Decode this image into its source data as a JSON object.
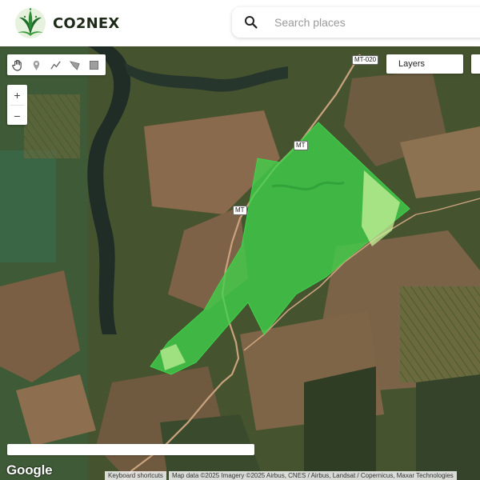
{
  "brand": {
    "name": "CO2NEX"
  },
  "search": {
    "placeholder": "Search places",
    "value": ""
  },
  "map": {
    "road_labels": [
      "MT-020",
      "MT",
      "MT"
    ],
    "layers_label": "Layers",
    "zoom_in_label": "+",
    "zoom_out_label": "−",
    "polygon_color": "#3fd24a",
    "draw_tools": [
      "hand-icon",
      "marker-icon",
      "polyline-icon",
      "polygon-icon",
      "rectangle-icon"
    ]
  },
  "footer": {
    "google_label": "Google",
    "keyboard_shortcuts": "Keyboard shortcuts",
    "attribution": "Map data ©2025 Imagery ©2025 Airbus, CNES / Airbus, Landsat / Copernicus, Maxar Technologies"
  }
}
